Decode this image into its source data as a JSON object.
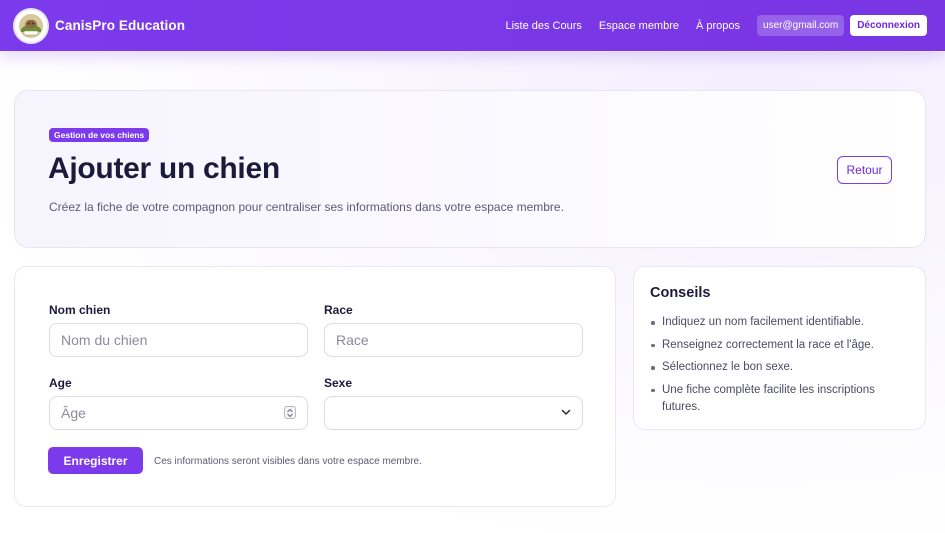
{
  "navbar": {
    "brand": "CanisPro Education",
    "links": [
      "Liste des Cours",
      "Espace membre",
      "À propos"
    ],
    "user_email": "user@gmail.com",
    "logout_label": "Déconnexion",
    "logo_text": "CANIS"
  },
  "hero": {
    "badge": "Gestion de vos chiens",
    "title": "Ajouter un chien",
    "subtitle": "Créez la fiche de votre compagnon pour centraliser ses informations dans votre espace membre.",
    "back_label": "Retour"
  },
  "form": {
    "name_label": "Nom chien",
    "name_placeholder": "Nom du chien",
    "name_value": "",
    "breed_label": "Race",
    "breed_placeholder": "Race",
    "breed_value": "",
    "age_label": "Age",
    "age_placeholder": "Âge",
    "age_value": "",
    "sex_label": "Sexe",
    "sex_selected": "",
    "save_label": "Enregistrer",
    "save_note": "Ces informations seront visibles dans votre espace membre."
  },
  "tips": {
    "title": "Conseils",
    "items": [
      "Indiquez un nom facilement identifiable.",
      "Renseignez correctement la race et l'âge.",
      "Sélectionnez le bon sexe.",
      "Une fiche complète facilite les inscriptions futures."
    ]
  },
  "colors": {
    "primary": "#7c3aed",
    "text_dark": "#1c1a3b",
    "text_muted": "#5b5b73",
    "border": "#dcdbe6"
  }
}
